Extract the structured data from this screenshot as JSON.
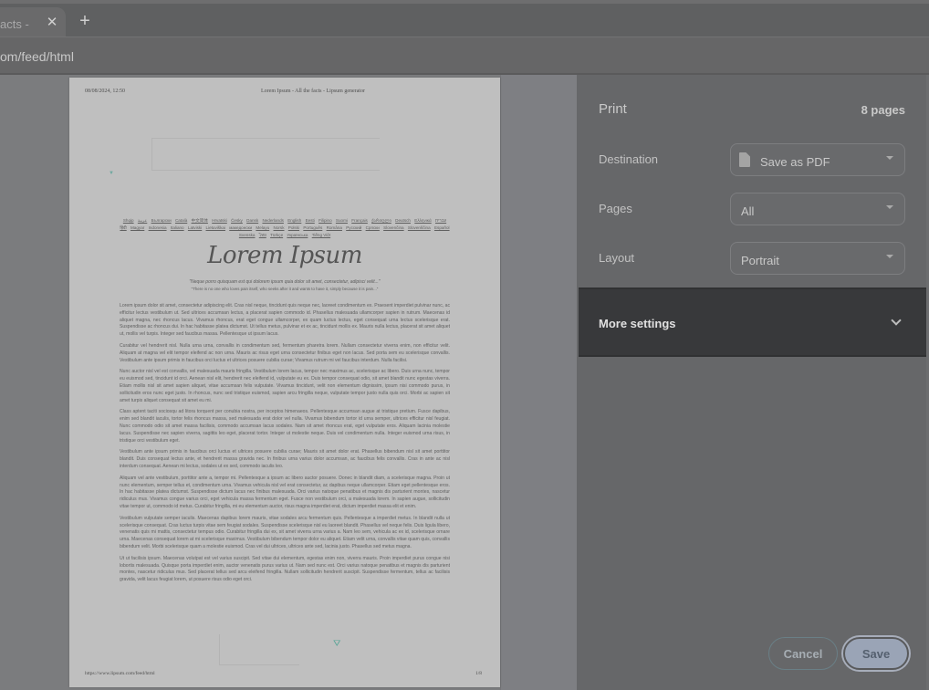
{
  "browser": {
    "tab": {
      "title": "acts -",
      "close_icon": "close-icon",
      "new_tab_icon": "plus-icon"
    },
    "url": "om/feed/html"
  },
  "preview": {
    "header_date": "08/08/2024, 12:50",
    "header_title": "Lorem Ipsum - All the facts - Lipsum generator",
    "languages": [
      "Shqip",
      "عربية",
      "Български",
      "Català",
      "中文简体",
      "Hrvatski",
      "Česky",
      "Dansk",
      "Nederlands",
      "English",
      "Eesti",
      "Filipino",
      "Suomi",
      "Français",
      "ქართული",
      "Deutsch",
      "Ελληνικά",
      "עברית",
      "हिंदी",
      "Magyar",
      "Indonesia",
      "Italiano",
      "Latviski",
      "Lietuviškai",
      "македонски",
      "Melayu",
      "Norsk",
      "Polski",
      "Português",
      "Româna",
      "Pyccкий",
      "Српски",
      "Slovenčina",
      "Slovenščina",
      "Español",
      "Svenska",
      "ไทย",
      "Türkçe",
      "Українська",
      "Tiếng Việt"
    ],
    "title": "Lorem Ipsum",
    "quote": "\"Neque porro quisquam est qui dolorem ipsum quia dolor sit amet, consectetur, adipisci velit...\"",
    "quote_translation": "\"There is no one who loves pain itself, who seeks after it and wants to have it, simply because it is pain...\"",
    "paragraphs": [
      "Lorem ipsum dolor sit amet, consectetur adipiscing elit. Cras nisl neque, tincidunt quis neque nec, laoreet condimentum ex. Praesent imperdiet pulvinar nunc, ac efficitur lectus vestibulum ut. Sed ultrices accumsan lectus, a placerat sapien commodo id. Phasellus malesuada ullamcorper sapien in rutrum. Maecenas id aliquet magna, nec rhoncus lacus. Vivamus rhoncus, erat eget congue ullamcorper, ex quam luctus lectus, eget consequat urna lectus scelerisque erat. Suspendisse ac rhoncus dui. In hac habitasse platea dictumst. Ut tellus metus, pulvinar et ex ac, tincidunt mollis ex. Mauris nulla lectus, placerat sit amet aliquet ut, mollis vel turpis. Integer sed faucibus massa. Pellentesque ut ipsum lacus.",
      "Curabitur vel hendrerit nisl. Nulla urna urna, convallis in condimentum sed, fermentum pharetra lorem. Nullam consectetur viverra enim, non efficitur velit. Aliquam at magna vel elit tempor eleifend ac non urna. Mauris ac risus eget urna consectetur finibus eget non lacus. Sed porta sem eu scelerisque convallis. Vestibulum ante ipsum primis in faucibus orci luctus et ultrices posuere cubilia curae; Vivamus rutrum mi vel faucibus interdum. Nulla facilisi.",
      "Nunc auctor nisl vel est convallis, vel malesuada mauris fringilla. Vestibulum lorem lacus, tempor nec maximus ac, scelerisque ac libero. Duis urna nunc, tempor eu euismod sed, tincidunt id orci. Aenean nisl elit, hendrerit nec eleifend id, vulputate eu ex. Duis tempor consequat odio, sit amet blandit nunc egestas viverra. Etiam mollis nisl sit amet sapien aliquet, vitae accumsan felis vulputate. Vivamus tincidunt, velit non elementum dignissim, ipsum nisi commodo purus, in sollicitudin eros nunc eget justo. In rhoncus, nunc sed tristique euismod, sapien arcu fringilla neque, vulputate tempor justo nulla quis orci. Morbi ac sapien sit amet turpis aliquet consequat sit amet eu mi.",
      "Class aptent taciti sociosqu ad litora torquent per conubia nostra, per inceptos himenaeos. Pellentesque accumsan augue at tristique pretium. Fusce dapibus, enim sed blandit iaculis, tortor felis rhoncus massa, sed malesuada erat dolor vel nulla. Vivamus bibendum tortor id urna semper, ultrices efficitur nisl feugiat. Nunc commodo odio sit amet massa facilisis, commodo accumsan lacus sodales. Nam sit amet rhoncus erat, eget vulputate eros. Aliquam lacinia molestie lacus. Suspendisse nec sapien viverra, sagittis leo eget, placerat tortor. Integer ut molestie neque. Duis vel condimentum nulla. Integer euismod urna risus, in tristique orci vestibulum eget.",
      "Vestibulum ante ipsum primis in faucibus orci luctus et ultrices posuere cubilia curae; Mauris sit amet dolor erat. Phasellus bibendum nisl sit amet porttitor blandit. Duis consequat lectus ante, et hendrerit massa gravida nec. In finibus urna varius dolor accumsan, ac faucibus felis convallis. Cras in ante ac nisl interdum consequat. Aenean mi lectus, sodales ut ex sed, commodo iaculis leo.",
      "Aliquam vel ante vestibulum, porttitor ante a, tempor mi. Pellentesque a ipsum ac libero auctor posuere. Donec in blandit diam, a scelerisque magna. Proin ut nunc elementum, semper tellus et, condimentum urna. Vivamus vehicula nisl vel erat consectetur, ac dapibus neque ullamcorper. Etiam eget pellentesque eros. In hac habitasse platea dictumst. Suspendisse dictum lacus nec finibus malesuada. Orci varius natoque penatibus et magnis dis parturient montes, nascetur ridiculus mus. Vivamus congue varius orci, eget vehicula massa fermentum eget. Fusce non vestibulum orci, a malesuada lorem. In sapien augue, sollicitudin vitae tempor ut, commodo id metus. Curabitur fringilla, mi eu elementum auctor, risus magna imperdiet erat, dictum imperdiet massa elit et enim.",
      "Vestibulum vulputate semper iaculis. Maecenas dapibus lorem mauris, vitae sodales arcu fermentum quis. Pellentesque a imperdiet metus. In blandit nulla ut scelerisque consequat. Cras luctus turpis vitae sem feugiat sodales. Suspendisse scelerisque nisl eu laoreet blandit. Phasellus vel neque felis. Duis ligula libero, venenatis quis mi mattis, consectetur tempus odio. Curabitur fringilla dui ex, sit amet viverra urna varius a. Nam leo sem, vehicula ac ex id, scelerisque ornare urna. Maecenas consequat lorem at mi scelerisque maximus. Vestibulum bibendum tempor dolor eu aliquet. Etiam velit urna, convallis vitae quam quis, convallis bibendum velit. Morbi scelerisque quam a molestie euismod. Cras vel dui ultrices, ultrices ante sed, lacinia justo. Phasellus sed metus magna.",
      "Ut ut facilisis ipsum. Maecenas volutpat est vel varius suscipit. Sed vitae dui elementum, egestas enim non, viverra mauris. Proin imperdiet purus congue nisi lobortis malesuada. Quisque porta imperdiet enim, auctor venenatis purus varius ut. Nam sed nunc est. Orci varius natoque penatibus et magnis dis parturient montes, nascetur ridiculus mus. Sed placerat tellus sed arcu eleifend fringilla. Nullam sollicitudin hendrerit suscipit. Suspendisse fermentum, tellus ac facilisis gravida, velit lacus feugiat lorem, ut posuere risus odio eget orci."
    ],
    "footer_url": "https://www.lipsum.com/feed/html",
    "footer_page": "1/8"
  },
  "print_panel": {
    "title": "Print",
    "page_count": "8 pages",
    "destination": {
      "label": "Destination",
      "value": "Save as PDF",
      "icon": "file-icon"
    },
    "pages": {
      "label": "Pages",
      "value": "All"
    },
    "layout": {
      "label": "Layout",
      "value": "Portrait"
    },
    "more_settings": {
      "label": "More settings",
      "icon": "chevron-down-icon"
    },
    "cancel_label": "Cancel",
    "save_label": "Save"
  }
}
